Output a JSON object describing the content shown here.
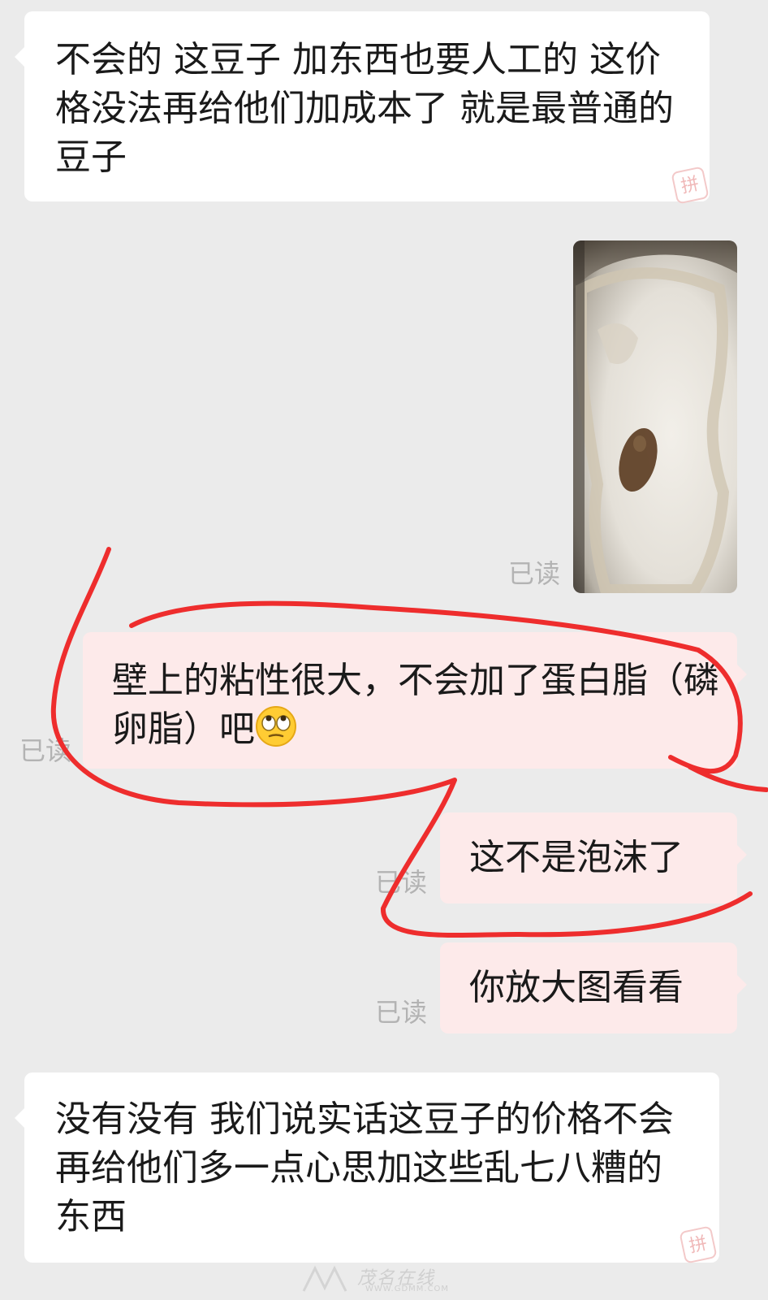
{
  "messages": [
    {
      "id": "m1",
      "side": "incoming",
      "text": "不会的 这豆子 加东西也要人工的 这价格没法再给他们加成本了  就是最普通的豆子"
    },
    {
      "id": "m2",
      "side": "outgoing",
      "type": "image",
      "status": "已读",
      "image_desc_icon": "photo-of-white-bowl-residue"
    },
    {
      "id": "m3",
      "side": "outgoing",
      "text": "壁上的粘性很大，不会加了蛋白脂（磷卵脂）吧",
      "emoji": "eye-roll-emoji",
      "status": "已读"
    },
    {
      "id": "m4",
      "side": "outgoing",
      "text": "这不是泡沫了",
      "status": "已读"
    },
    {
      "id": "m5",
      "side": "outgoing",
      "text": "你放大图看看",
      "status": "已读"
    },
    {
      "id": "m6",
      "side": "incoming",
      "text": "没有没有 我们说实话这豆子的价格不会再给他们多一点心思加这些乱七八糟的  东西"
    }
  ],
  "badges": {
    "pin_label": "拼"
  },
  "watermark": {
    "main": "茂名在线",
    "sub": "WWW.GDMM.COM"
  },
  "colors": {
    "background": "#ebebeb",
    "incoming_bubble": "#ffffff",
    "outgoing_bubble": "#fdeaea",
    "read_status": "#b3b3b3",
    "annotation_stroke": "#ee2d2d"
  }
}
